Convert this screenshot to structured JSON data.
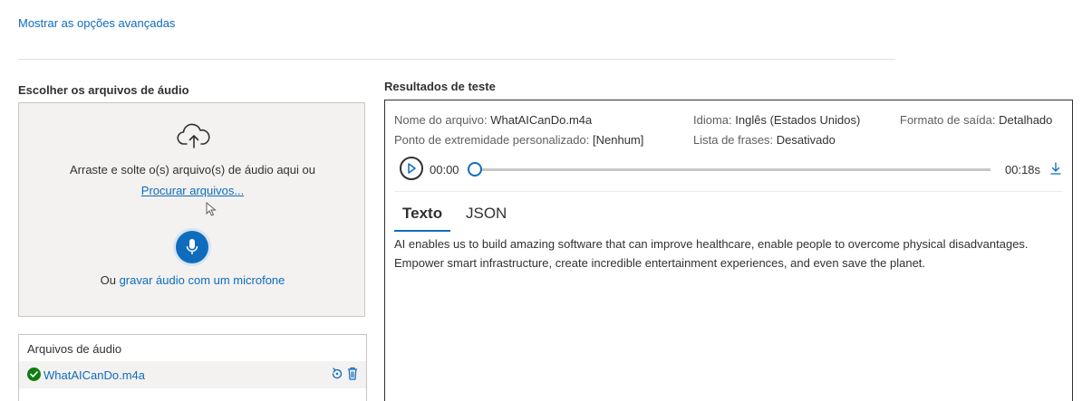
{
  "advanced_link": "Mostrar as opções avançadas",
  "left": {
    "title": "Escolher os arquivos de áudio",
    "drop_text": "Arraste e solte o(s) arquivo(s) de áudio aqui ou",
    "browse_link": "Procurar arquivos...",
    "mic_prefix": "Ou ",
    "mic_link": "gravar áudio com um microfone"
  },
  "files": {
    "title": "Arquivos de áudio",
    "items": [
      {
        "name": "WhatAICanDo.m4a",
        "status": "success"
      }
    ]
  },
  "results": {
    "title": "Resultados de teste",
    "meta": {
      "file_label": "Nome do arquivo:",
      "file_value": "WhatAICanDo.m4a",
      "lang_label": "Idioma:",
      "lang_value": "Inglês (Estados Unidos)",
      "format_label": "Formato de saída:",
      "format_value": "Detalhado",
      "endpoint_label": "Ponto de extremidade personalizado:",
      "endpoint_value": "[Nenhum]",
      "phrases_label": "Lista de frases:",
      "phrases_value": "Desativado"
    },
    "player": {
      "current_time": "00:00",
      "duration": "00:18s",
      "progress": 0
    },
    "tabs": [
      {
        "label": "Texto",
        "selected": true
      },
      {
        "label": "JSON",
        "selected": false
      }
    ],
    "text": "AI enables us to build amazing software that can improve healthcare, enable people to overcome physical disadvantages. Empower smart infrastructure, create incredible entertainment experiences, and even save the planet."
  },
  "colors": {
    "accent": "#0f6cbd",
    "success": "#107c10",
    "text": "#323130"
  }
}
